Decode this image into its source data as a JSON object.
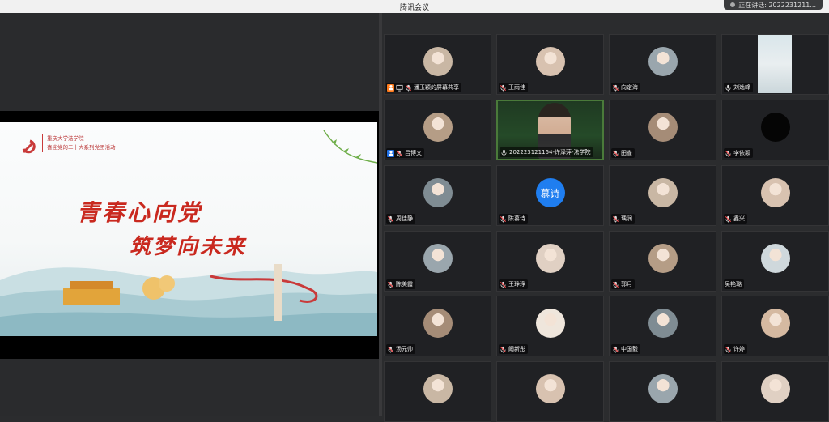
{
  "window": {
    "title": "腾讯会议",
    "recording_text": "正在讲话: 2022231211...",
    "accent": "#1f7ef0"
  },
  "slide": {
    "org_line1": "重庆大学法学院",
    "org_line2": "喜迎党的二十大系列党团活动",
    "title_line1": "青春心向党",
    "title_line2": "筑梦向未来",
    "title_color": "#c9291f"
  },
  "participants": [
    {
      "name": "潘玉颖的屏幕共享",
      "avatar": "photo",
      "icons": [
        "person-icon",
        "screen-share-icon",
        "mic-muted-icon"
      ]
    },
    {
      "name": "王雨佳",
      "avatar": "photo",
      "icons": [
        "mic-muted-icon"
      ]
    },
    {
      "name": "向定海",
      "avatar": "photo",
      "icons": [
        "mic-muted-icon"
      ]
    },
    {
      "name": "刘逸峰",
      "avatar": "camera",
      "icons": [
        "mic-icon"
      ]
    },
    {
      "name": "吕博文",
      "avatar": "photo",
      "icons": [
        "person-icon",
        "mic-muted-icon"
      ]
    },
    {
      "name": "2022231211​64-许泽萍-法学院",
      "avatar": "video",
      "icons": [
        "mic-icon"
      ],
      "active": true
    },
    {
      "name": "田雀",
      "avatar": "photo",
      "icons": [
        "mic-muted-icon"
      ]
    },
    {
      "name": "李依颖",
      "avatar": "dark",
      "icons": [
        "mic-muted-icon"
      ]
    },
    {
      "name": "周佳静",
      "avatar": "photo",
      "icons": [
        "mic-muted-icon"
      ]
    },
    {
      "name": "陈慕诗",
      "avatar": "text",
      "avatar_text": "慕诗",
      "icons": [
        "mic-muted-icon"
      ]
    },
    {
      "name": "瑀润",
      "avatar": "photo",
      "icons": [
        "mic-muted-icon"
      ]
    },
    {
      "name": "鑫兴",
      "avatar": "photo",
      "icons": [
        "mic-muted-icon"
      ]
    },
    {
      "name": "陈美霞",
      "avatar": "photo",
      "icons": [
        "mic-muted-icon"
      ]
    },
    {
      "name": "王琤琤",
      "avatar": "photo",
      "icons": [
        "mic-muted-icon"
      ]
    },
    {
      "name": "郭月",
      "avatar": "photo",
      "icons": [
        "mic-muted-icon"
      ]
    },
    {
      "name": "吴艳璐",
      "avatar": "photo",
      "icons": []
    },
    {
      "name": "汤元帅",
      "avatar": "photo",
      "icons": [
        "mic-muted-icon"
      ]
    },
    {
      "name": "阚新彤",
      "avatar": "photo",
      "icons": [
        "mic-muted-icon"
      ]
    },
    {
      "name": "中国毅",
      "avatar": "photo",
      "icons": [
        "mic-muted-icon"
      ]
    },
    {
      "name": "许婷",
      "avatar": "photo",
      "icons": [
        "mic-muted-icon"
      ]
    },
    {
      "name": "",
      "avatar": "photo",
      "icons": []
    },
    {
      "name": "",
      "avatar": "photo",
      "icons": []
    },
    {
      "name": "",
      "avatar": "photo",
      "icons": []
    },
    {
      "name": "",
      "avatar": "photo",
      "icons": []
    }
  ]
}
